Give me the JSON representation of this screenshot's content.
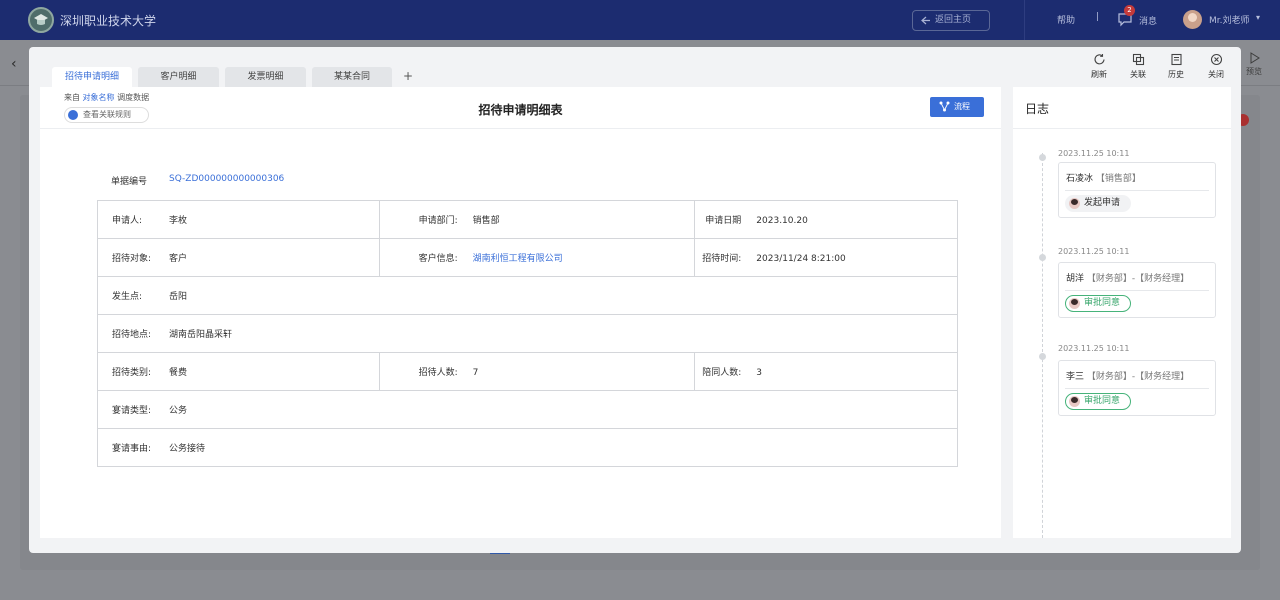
{
  "app": {
    "brand": "深圳职业技术大学",
    "home_button": "返回主页",
    "help": "帮助",
    "separator": "|",
    "messages_label": "消息",
    "messages_count": "2",
    "user": "Mr.刘老师",
    "preview_label": "预览"
  },
  "tabs": [
    {
      "label": "招待申请明细",
      "active": true
    },
    {
      "label": "客户明细"
    },
    {
      "label": "发票明细"
    },
    {
      "label": "某某合同"
    }
  ],
  "tab_add": "+",
  "toolbar": {
    "refresh": "刷新",
    "link": "关联",
    "history": "历史",
    "close": "关闭"
  },
  "source": {
    "prefix": "来自",
    "object_name": "对象名称",
    "suffix": "调度数据",
    "rule_button": "查看关联规则"
  },
  "form": {
    "title": "招待申请明细表",
    "flow_button": "流程",
    "doc_no_label": "单据编号",
    "doc_no": "SQ-ZD000000000000306",
    "applicant_label": "申请人:",
    "applicant": "李枚",
    "department_label": "申请部门:",
    "department": "销售部",
    "apply_date_label": "申请日期",
    "apply_date": "2023.10.20",
    "target_label": "招待对象:",
    "target": "客户",
    "customer_info_label": "客户信息:",
    "customer_info": "湖南利恒工程有限公司",
    "reception_time_label": "招待时间:",
    "reception_time": "2023/11/24  8:21:00",
    "origin_label": "发生点:",
    "origin": "岳阳",
    "location_label": "招待地点:",
    "location": "湖南岳阳晶采轩",
    "category_label": "招待类别:",
    "category": "餐费",
    "guests_label": "招待人数:",
    "guests": "7",
    "companions_label": "陪同人数:",
    "companions": "3",
    "banquet_type_label": "宴请类型:",
    "banquet_type": "公务",
    "banquet_reason_label": "宴请事由:",
    "banquet_reason": "公务接待"
  },
  "log": {
    "title": "日志",
    "entries": [
      {
        "time": "2023.11.25  10:11",
        "name": "石凌冰",
        "dept": "【销售部】",
        "action": "发起申请",
        "status": "submitted"
      },
      {
        "time": "2023.11.25  10:11",
        "name": "胡洋",
        "dept": "【财务部】-【财务经理】",
        "action": "审批同意",
        "status": "approved"
      },
      {
        "time": "2023.11.25  10:11",
        "name": "李三",
        "dept": "【财务部】-【财务经理】",
        "action": "审批同意",
        "status": "approved"
      }
    ]
  },
  "colors": {
    "header": "#1c2c70",
    "accent": "#3a6fd8",
    "approved": "#37a66b"
  }
}
